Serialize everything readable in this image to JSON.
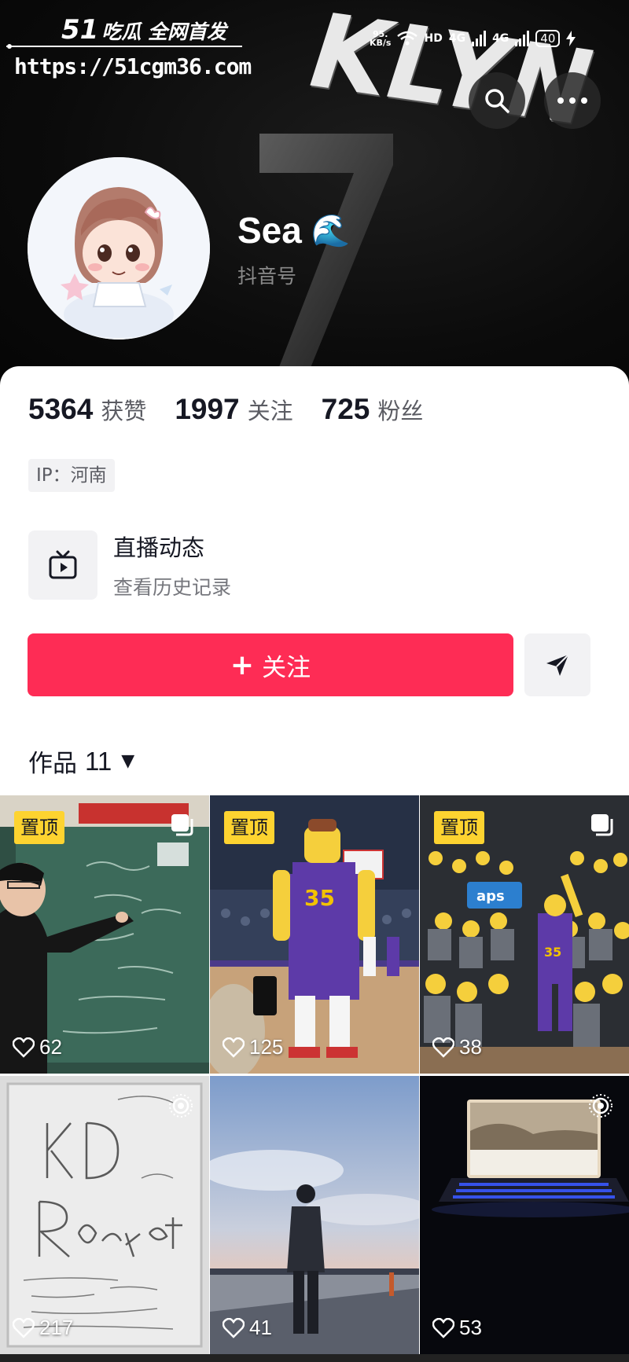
{
  "watermark": {
    "brand_num": "51",
    "brand_cn": "吃瓜 全网首发",
    "url": "https://51cgm36.com"
  },
  "header": {
    "overlay_text": "KLYN",
    "jersey_number": "7"
  },
  "status_bar": {
    "speed_value": "95.",
    "speed_unit": "KB/s",
    "hd": "HD",
    "net1": "4G",
    "net2": "4G",
    "battery": "40"
  },
  "profile": {
    "nickname": "Sea",
    "nickname_emoji": "🌊",
    "id_label": "抖音号"
  },
  "stats": [
    {
      "value": "5364",
      "label": "获赞"
    },
    {
      "value": "1997",
      "label": "关注"
    },
    {
      "value": "725",
      "label": "粉丝"
    }
  ],
  "ip_tag": "IP：河南",
  "live": {
    "title": "直播动态",
    "subtitle": "查看历史记录"
  },
  "actions": {
    "follow_label": "关注",
    "follow_plus": "+"
  },
  "works": {
    "label": "作品",
    "count": "11",
    "caret": "▼"
  },
  "tiles": [
    {
      "pinned": "置顶",
      "likes": "62",
      "corner": "multi"
    },
    {
      "pinned": "置顶",
      "likes": "125",
      "corner": "none"
    },
    {
      "pinned": "置顶",
      "likes": "38",
      "corner": "multi"
    },
    {
      "pinned": "",
      "likes": "217",
      "corner": "live"
    },
    {
      "pinned": "",
      "likes": "41",
      "corner": "none"
    },
    {
      "pinned": "",
      "likes": "53",
      "corner": "live"
    }
  ],
  "colors": {
    "accent": "#fe2c55",
    "pin": "#fdd330"
  }
}
